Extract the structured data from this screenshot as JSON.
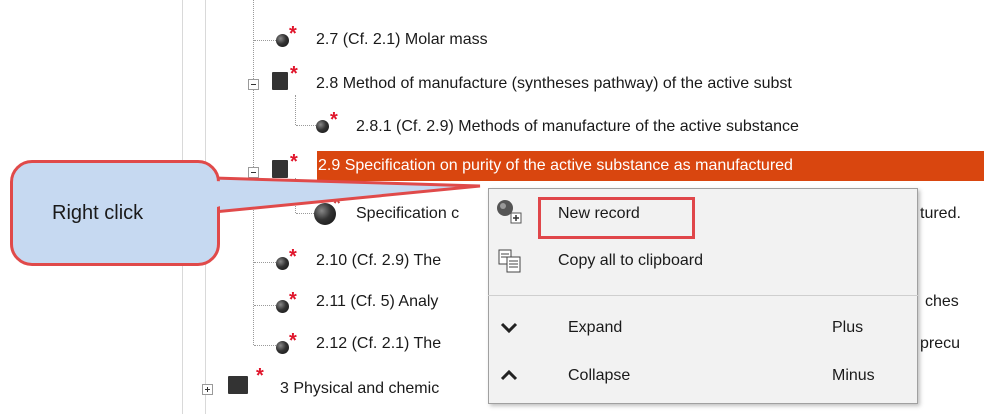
{
  "tree": {
    "items": [
      {
        "label": "2.7 (Cf. 2.1) Molar mass"
      },
      {
        "label": "2.8 Method of manufacture (syntheses pathway) of the active subst"
      },
      {
        "label": "2.8.1 (Cf. 2.9) Methods of manufacture of the active substance"
      },
      {
        "label": "2.9 Specification on purity of the active substance as manufactured"
      },
      {
        "label": "Specification c"
      },
      {
        "label": "tured."
      },
      {
        "label": "2.10 (Cf. 2.9) The"
      },
      {
        "label": "2.11 (Cf. 5) Analy"
      },
      {
        "label": "ches"
      },
      {
        "label": "2.12 (Cf. 2.1) The"
      },
      {
        "label": "precu"
      },
      {
        "label": "3 Physical and chemic"
      }
    ]
  },
  "callout": {
    "text": "Right click"
  },
  "context_menu": {
    "new_record": "New record",
    "copy_all": "Copy all to clipboard",
    "expand": "Expand",
    "expand_shortcut": "Plus",
    "collapse": "Collapse",
    "collapse_shortcut": "Minus"
  },
  "colors": {
    "selection": "#d9460f",
    "callout_fill": "#c6d9f1",
    "callout_border": "#e04a4a",
    "required_star": "#e0152b"
  }
}
